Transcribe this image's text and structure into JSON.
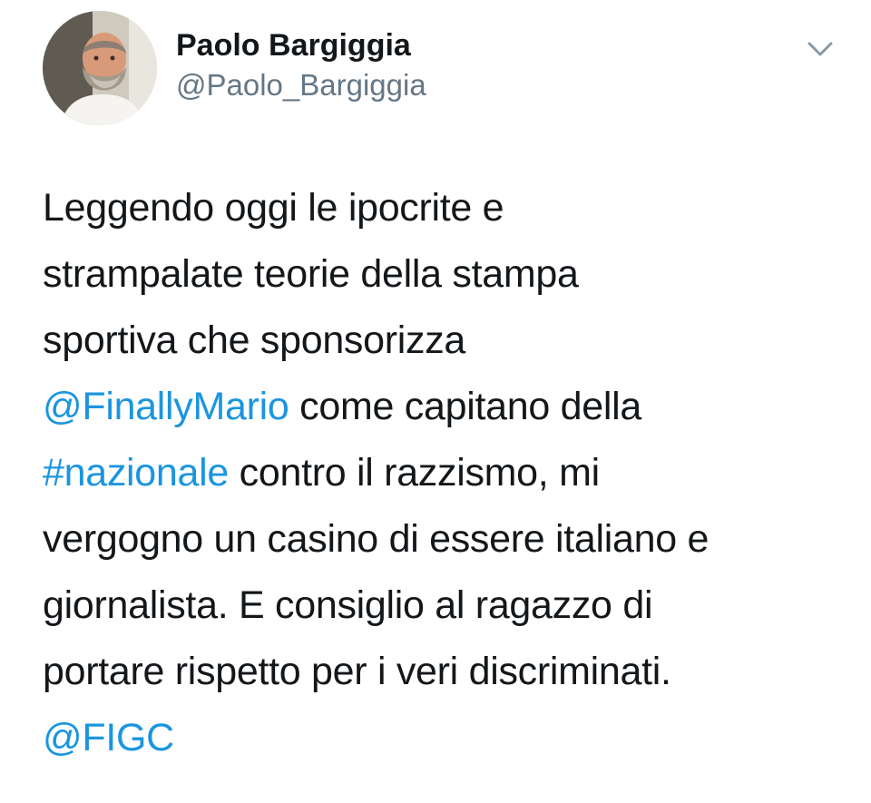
{
  "tweet": {
    "author": {
      "display_name": "Paolo Bargiggia",
      "handle": "@Paolo_Bargiggia"
    },
    "menu_icon": "chevron-down-icon",
    "lines": {
      "l1": "Leggendo oggi le ipocrite e",
      "l2": "strampalate teorie della stampa",
      "l3": "sportiva che sponsorizza",
      "l4_mention": "@FinallyMario",
      "l4_rest": " come capitano della",
      "l5_hashtag": "#nazionale",
      "l5_rest": " contro il razzismo, mi",
      "l6": "vergogno un casino di essere italiano e",
      "l7": "giornalista. E consiglio al ragazzo di",
      "l8": "portare rispetto per i veri discriminati.",
      "l9_mention": "@FIGC"
    }
  },
  "colors": {
    "text": "#14171a",
    "secondary": "#657786",
    "link": "#1b95e0"
  }
}
